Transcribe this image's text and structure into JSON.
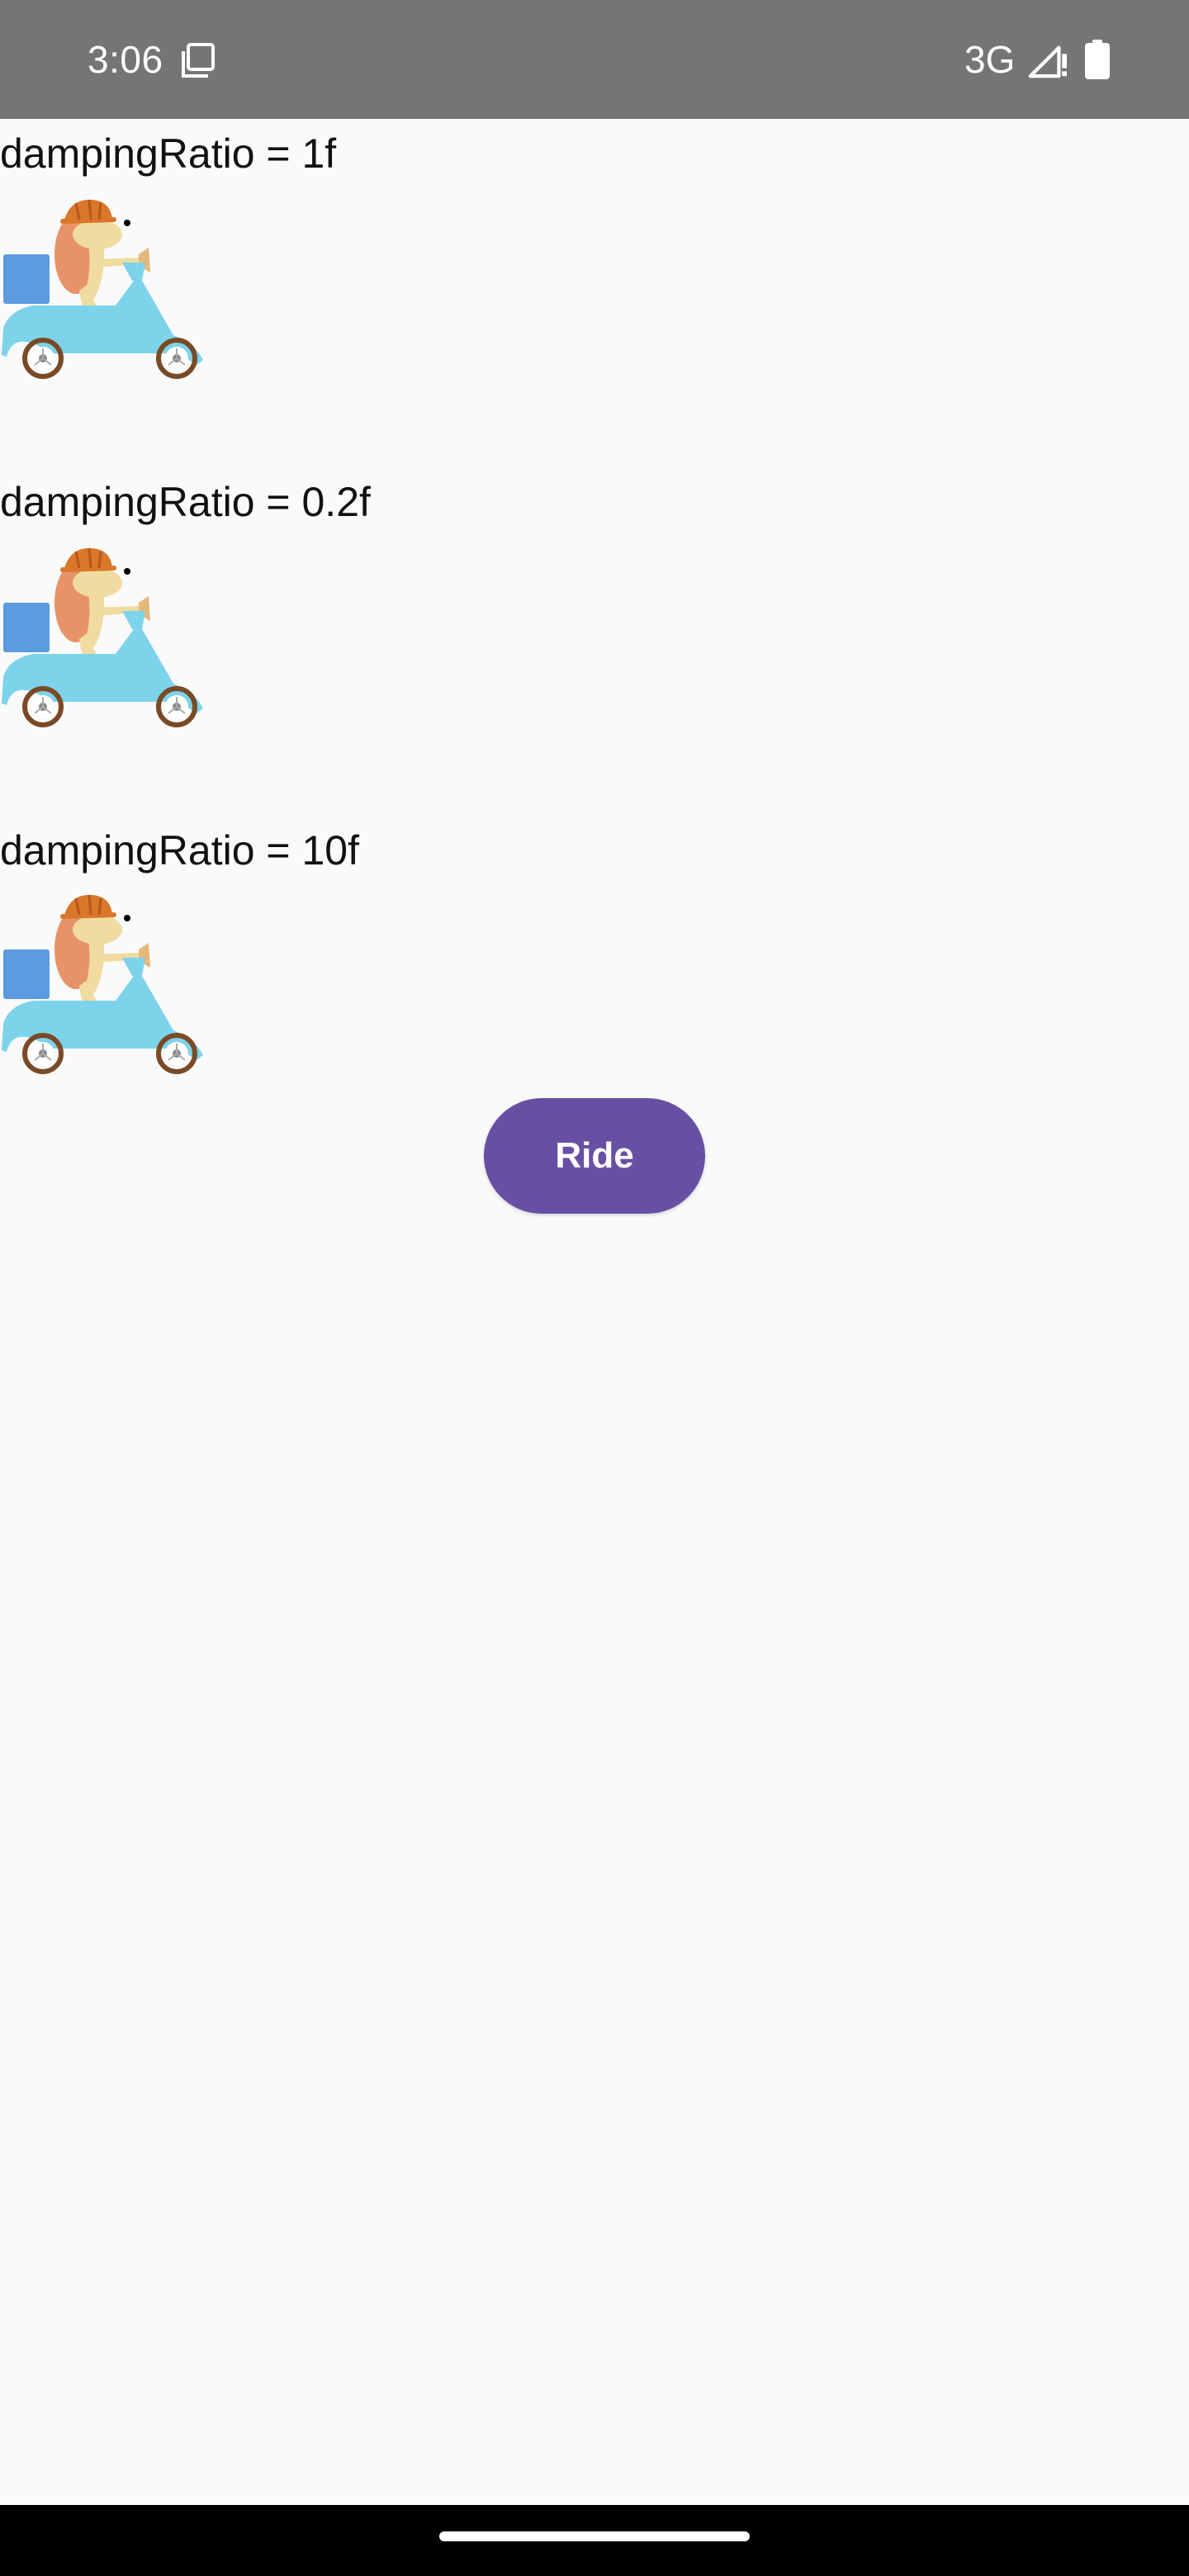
{
  "status_bar": {
    "time": "3:06",
    "network": "3G",
    "icons": [
      "screenshot-icon",
      "signal-icon",
      "battery-icon"
    ]
  },
  "demos": [
    {
      "label": "dampingRatio = 1f"
    },
    {
      "label": "dampingRatio = 0.2f"
    },
    {
      "label": "dampingRatio = 10f"
    }
  ],
  "ride_button": {
    "label": "Ride"
  },
  "colors": {
    "status_bar": "#757575",
    "background": "#fafafa",
    "accent": "#6750a4",
    "scooter": "#7dd3ea",
    "box": "#5b9be0",
    "shell": "#e8926a",
    "body": "#f0dca0",
    "helmet": "#d9772b",
    "wheel": "#7a4a26"
  }
}
